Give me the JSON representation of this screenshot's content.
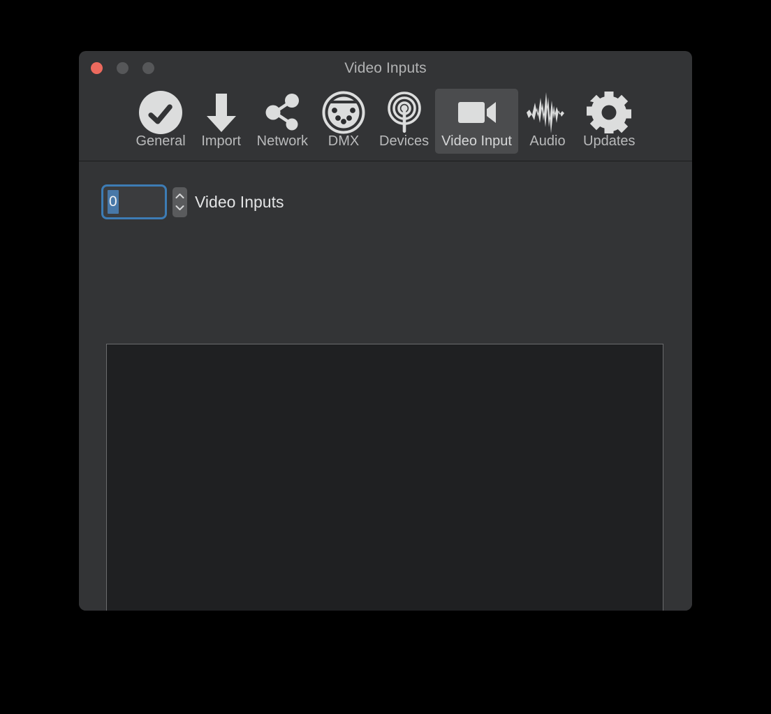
{
  "window": {
    "title": "Video Inputs",
    "traffic_lights": [
      {
        "name": "close",
        "color": "#ec6a5e"
      },
      {
        "name": "minimize",
        "color": "#565759"
      },
      {
        "name": "zoom",
        "color": "#565759"
      }
    ],
    "background": "#333436"
  },
  "toolbar": {
    "items": [
      {
        "label": "General",
        "icon": "check-circle-icon",
        "selected": false
      },
      {
        "label": "Import",
        "icon": "download-arrow-icon",
        "selected": false
      },
      {
        "label": "Network",
        "icon": "share-nodes-icon",
        "selected": false
      },
      {
        "label": "DMX",
        "icon": "dmx-din-connector-icon",
        "selected": false
      },
      {
        "label": "Devices",
        "icon": "broadcast-antenna-icon",
        "selected": false
      },
      {
        "label": "Video Input",
        "icon": "video-camera-icon",
        "selected": true
      },
      {
        "label": "Audio",
        "icon": "audio-waveform-icon",
        "selected": false
      },
      {
        "label": "Updates",
        "icon": "gear-icon",
        "selected": false
      }
    ],
    "selected_background": "#4b4c4e"
  },
  "main": {
    "video_inputs_count": "0",
    "video_inputs_label": "Video Inputs",
    "stepper": {
      "increment_icon": "chevron-up-icon",
      "decrement_icon": "chevron-down-icon"
    },
    "field_focus_color": "#3d7cb5",
    "selection_color": "#4878a8",
    "list_panel": {
      "items": [],
      "background": "#1f2022",
      "border_color": "#6b6c6e"
    }
  }
}
